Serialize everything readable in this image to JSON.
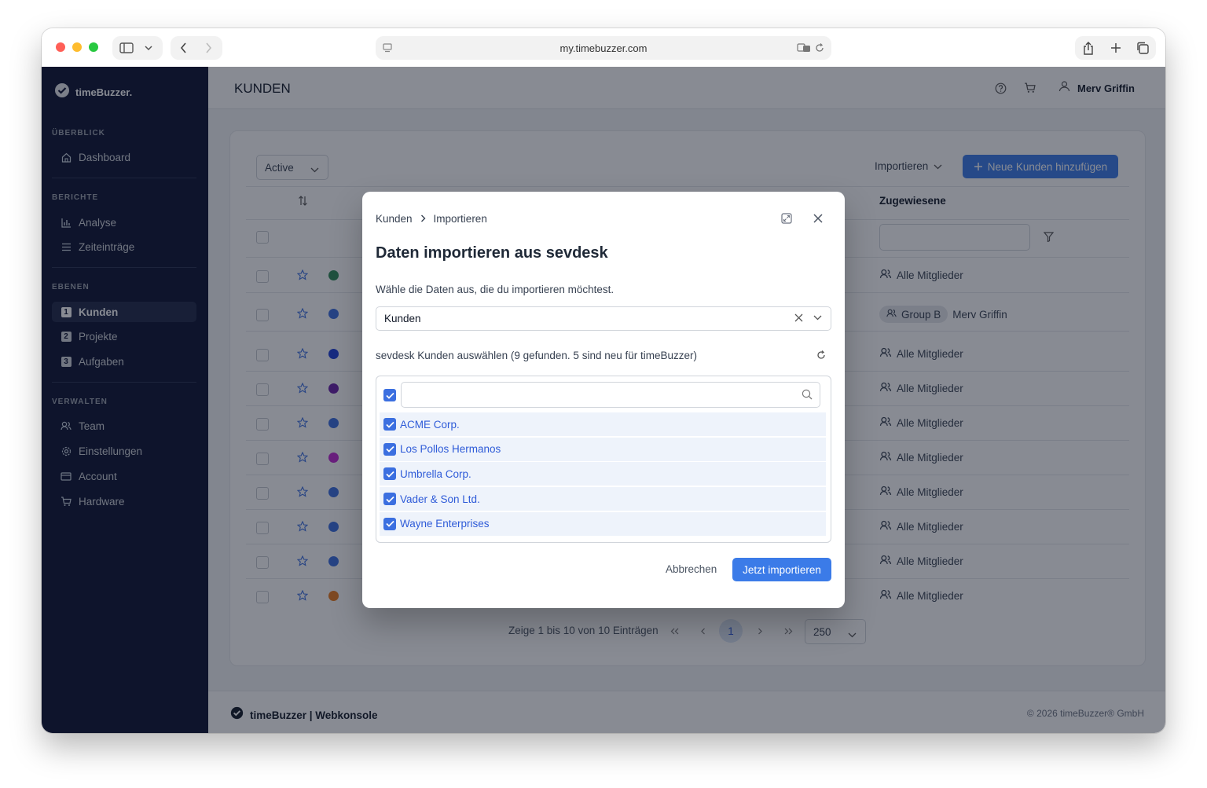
{
  "browser": {
    "url": "my.timebuzzer.com"
  },
  "sidebar": {
    "brand": "timeBuzzer.",
    "sections": {
      "overview": "ÜBERBLICK",
      "reports": "BERICHTE",
      "levels": "EBENEN",
      "manage": "VERWALTEN"
    },
    "items": {
      "dashboard": "Dashboard",
      "analyse": "Analyse",
      "zeiteintraege": "Zeiteinträge",
      "kunden": "Kunden",
      "projekte": "Projekte",
      "aufgaben": "Aufgaben",
      "team": "Team",
      "einstellungen": "Einstellungen",
      "account": "Account",
      "hardware": "Hardware"
    },
    "numbers": {
      "kunden": "1",
      "projekte": "2",
      "aufgaben": "3"
    }
  },
  "header": {
    "title": "KUNDEN",
    "user": "Merv Griffin"
  },
  "toolbar": {
    "filter_value": "Active",
    "import_label": "Importieren",
    "add_label": "Neue Kunden hinzufügen"
  },
  "table": {
    "col_assigned": "Zugewiesene",
    "rows": [
      {
        "color": "#2e8b57",
        "assigned": "Alle Mitglieder"
      },
      {
        "color": "#3b6fe0",
        "assigned_group": "Group B",
        "assigned": "Merv Griffin"
      },
      {
        "color": "#1d3fd8",
        "assigned": "Alle Mitglieder"
      },
      {
        "color": "#6b21a8",
        "assigned": "Alle Mitglieder"
      },
      {
        "color": "#3b6fe0",
        "assigned": "Alle Mitglieder"
      },
      {
        "color": "#c026d3",
        "assigned": "Alle Mitglieder"
      },
      {
        "color": "#3b6fe0",
        "assigned": "Alle Mitglieder"
      },
      {
        "color": "#3b6fe0",
        "assigned": "Alle Mitglieder"
      },
      {
        "color": "#3b6fe0",
        "assigned": "Alle Mitglieder"
      },
      {
        "color": "#ea7a1c",
        "assigned": "Alle Mitglieder"
      }
    ]
  },
  "pagination": {
    "info": "Zeige 1 bis 10 von 10 Einträgen",
    "current": "1",
    "page_size": "250"
  },
  "footer": {
    "brand": "timeBuzzer | Webkonsole",
    "copyright": "© 2026 timeBuzzer® GmbH"
  },
  "modal": {
    "breadcrumb_root": "Kunden",
    "breadcrumb_current": "Importieren",
    "title": "Daten importieren aus sevdesk",
    "instruction": "Wähle die Daten aus, die du importieren möchtest.",
    "select_value": "Kunden",
    "list_caption": "sevdesk Kunden auswählen (9 gefunden. 5 sind neu für timeBuzzer)",
    "search_placeholder": "",
    "customers": [
      "ACME Corp.",
      "Los Pollos Hermanos",
      "Umbrella Corp.",
      "Vader & Son Ltd.",
      "Wayne Enterprises"
    ],
    "cancel_label": "Abbrechen",
    "import_label": "Jetzt importieren"
  }
}
